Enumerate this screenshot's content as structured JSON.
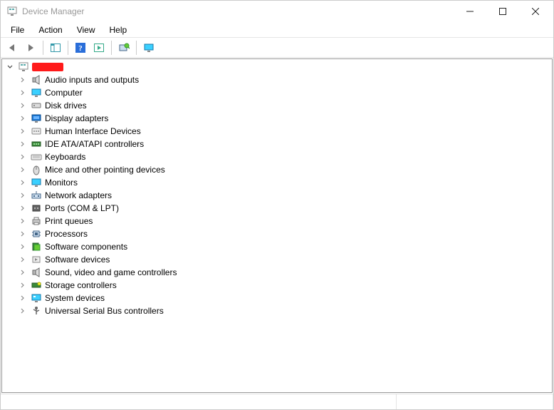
{
  "window": {
    "title": "Device Manager"
  },
  "menubar": {
    "file": "File",
    "action": "Action",
    "view": "View",
    "help": "Help"
  },
  "tree": {
    "root_redacted": true,
    "categories": [
      {
        "label": "Audio inputs and outputs",
        "icon": "speaker"
      },
      {
        "label": "Computer",
        "icon": "monitor"
      },
      {
        "label": "Disk drives",
        "icon": "disk"
      },
      {
        "label": "Display adapters",
        "icon": "display"
      },
      {
        "label": "Human Interface Devices",
        "icon": "hid"
      },
      {
        "label": "IDE ATA/ATAPI controllers",
        "icon": "ide"
      },
      {
        "label": "Keyboards",
        "icon": "keyboard"
      },
      {
        "label": "Mice and other pointing devices",
        "icon": "mouse"
      },
      {
        "label": "Monitors",
        "icon": "monitor"
      },
      {
        "label": "Network adapters",
        "icon": "network"
      },
      {
        "label": "Ports (COM & LPT)",
        "icon": "port"
      },
      {
        "label": "Print queues",
        "icon": "printer"
      },
      {
        "label": "Processors",
        "icon": "cpu"
      },
      {
        "label": "Software components",
        "icon": "swcomp"
      },
      {
        "label": "Software devices",
        "icon": "swdev"
      },
      {
        "label": "Sound, video and game controllers",
        "icon": "speaker"
      },
      {
        "label": "Storage controllers",
        "icon": "storage"
      },
      {
        "label": "System devices",
        "icon": "system"
      },
      {
        "label": "Universal Serial Bus controllers",
        "icon": "usb"
      }
    ]
  }
}
